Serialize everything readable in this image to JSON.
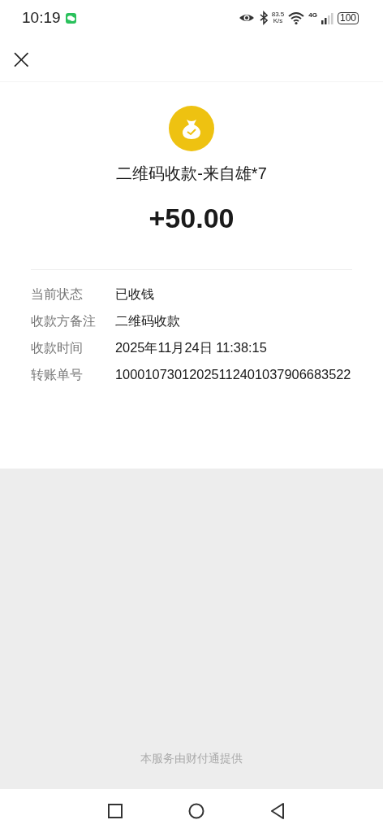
{
  "status_bar": {
    "time": "10:19",
    "net_speed": "83.5",
    "net_speed_unit": "K/s",
    "network": "4G",
    "battery": "100"
  },
  "header": {
    "close": "×"
  },
  "payment": {
    "title": "二维码收款-来自雄*7",
    "amount": "+50.00"
  },
  "details": [
    {
      "label": "当前状态",
      "value": "已收钱"
    },
    {
      "label": "收款方备注",
      "value": "二维码收款"
    },
    {
      "label": "收款时间",
      "value": "2025年11月24日 11:38:15"
    },
    {
      "label": "转账单号",
      "value": "10001073012025112401037906683522"
    }
  ],
  "footer": "本服务由财付通提供"
}
